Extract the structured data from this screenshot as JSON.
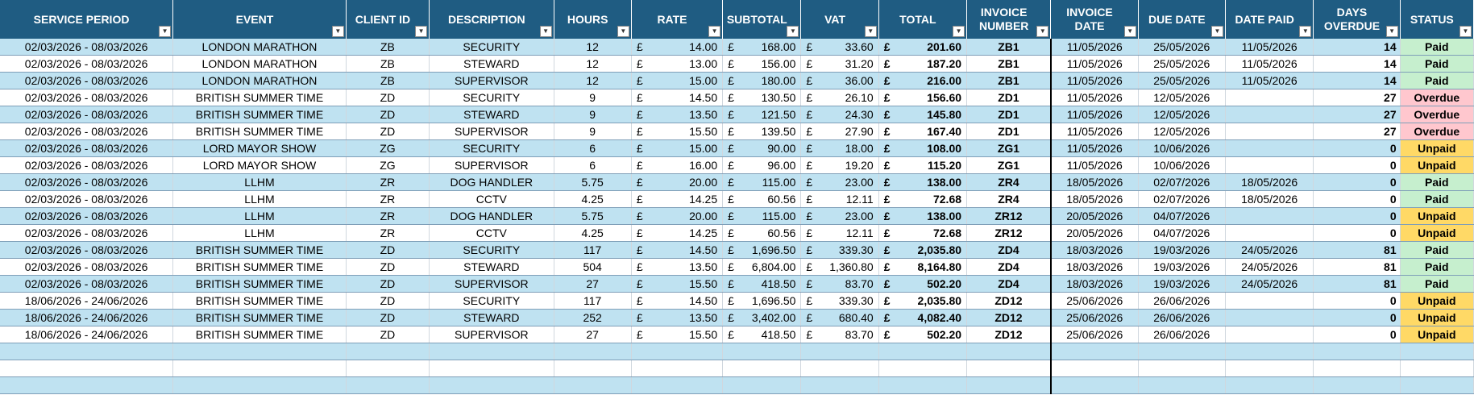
{
  "headers": [
    {
      "label": "SERVICE PERIOD"
    },
    {
      "label": "EVENT"
    },
    {
      "label": "CLIENT ID"
    },
    {
      "label": "DESCRIPTION"
    },
    {
      "label": "HOURS"
    },
    {
      "label": "RATE"
    },
    {
      "label": "SUBTOTAL"
    },
    {
      "label": "VAT"
    },
    {
      "label": "TOTAL"
    },
    {
      "label": "INVOICE NUMBER"
    },
    {
      "label": "INVOICE DATE"
    },
    {
      "label": "DUE DATE"
    },
    {
      "label": "DATE PAID"
    },
    {
      "label": "DAYS OVERDUE"
    },
    {
      "label": "STATUS"
    }
  ],
  "filter_icon": "dropdown-arrow-icon",
  "currency_symbol": "£",
  "rows": [
    {
      "period": "02/03/2026 - 08/03/2026",
      "event": "LONDON MARATHON",
      "client": "ZB",
      "desc": "SECURITY",
      "hours": "12",
      "rate": "14.00",
      "subtotal": "168.00",
      "vat": "33.60",
      "total": "201.60",
      "invoice": "ZB1",
      "inv_date": "11/05/2026",
      "due": "25/05/2026",
      "paid": "11/05/2026",
      "overdue": "14",
      "status": "Paid"
    },
    {
      "period": "02/03/2026 - 08/03/2026",
      "event": "LONDON MARATHON",
      "client": "ZB",
      "desc": "STEWARD",
      "hours": "12",
      "rate": "13.00",
      "subtotal": "156.00",
      "vat": "31.20",
      "total": "187.20",
      "invoice": "ZB1",
      "inv_date": "11/05/2026",
      "due": "25/05/2026",
      "paid": "11/05/2026",
      "overdue": "14",
      "status": "Paid"
    },
    {
      "period": "02/03/2026 - 08/03/2026",
      "event": "LONDON MARATHON",
      "client": "ZB",
      "desc": "SUPERVISOR",
      "hours": "12",
      "rate": "15.00",
      "subtotal": "180.00",
      "vat": "36.00",
      "total": "216.00",
      "invoice": "ZB1",
      "inv_date": "11/05/2026",
      "due": "25/05/2026",
      "paid": "11/05/2026",
      "overdue": "14",
      "status": "Paid"
    },
    {
      "period": "02/03/2026 - 08/03/2026",
      "event": "BRITISH SUMMER TIME",
      "client": "ZD",
      "desc": "SECURITY",
      "hours": "9",
      "rate": "14.50",
      "subtotal": "130.50",
      "vat": "26.10",
      "total": "156.60",
      "invoice": "ZD1",
      "inv_date": "11/05/2026",
      "due": "12/05/2026",
      "paid": "",
      "overdue": "27",
      "status": "Overdue"
    },
    {
      "period": "02/03/2026 - 08/03/2026",
      "event": "BRITISH SUMMER TIME",
      "client": "ZD",
      "desc": "STEWARD",
      "hours": "9",
      "rate": "13.50",
      "subtotal": "121.50",
      "vat": "24.30",
      "total": "145.80",
      "invoice": "ZD1",
      "inv_date": "11/05/2026",
      "due": "12/05/2026",
      "paid": "",
      "overdue": "27",
      "status": "Overdue"
    },
    {
      "period": "02/03/2026 - 08/03/2026",
      "event": "BRITISH SUMMER TIME",
      "client": "ZD",
      "desc": "SUPERVISOR",
      "hours": "9",
      "rate": "15.50",
      "subtotal": "139.50",
      "vat": "27.90",
      "total": "167.40",
      "invoice": "ZD1",
      "inv_date": "11/05/2026",
      "due": "12/05/2026",
      "paid": "",
      "overdue": "27",
      "status": "Overdue"
    },
    {
      "period": "02/03/2026 - 08/03/2026",
      "event": "LORD MAYOR SHOW",
      "client": "ZG",
      "desc": "SECURITY",
      "hours": "6",
      "rate": "15.00",
      "subtotal": "90.00",
      "vat": "18.00",
      "total": "108.00",
      "invoice": "ZG1",
      "inv_date": "11/05/2026",
      "due": "10/06/2026",
      "paid": "",
      "overdue": "0",
      "status": "Unpaid"
    },
    {
      "period": "02/03/2026 - 08/03/2026",
      "event": "LORD MAYOR SHOW",
      "client": "ZG",
      "desc": "SUPERVISOR",
      "hours": "6",
      "rate": "16.00",
      "subtotal": "96.00",
      "vat": "19.20",
      "total": "115.20",
      "invoice": "ZG1",
      "inv_date": "11/05/2026",
      "due": "10/06/2026",
      "paid": "",
      "overdue": "0",
      "status": "Unpaid"
    },
    {
      "period": "02/03/2026 - 08/03/2026",
      "event": "LLHM",
      "client": "ZR",
      "desc": "DOG HANDLER",
      "hours": "5.75",
      "rate": "20.00",
      "subtotal": "115.00",
      "vat": "23.00",
      "total": "138.00",
      "invoice": "ZR4",
      "inv_date": "18/05/2026",
      "due": "02/07/2026",
      "paid": "18/05/2026",
      "overdue": "0",
      "status": "Paid"
    },
    {
      "period": "02/03/2026 - 08/03/2026",
      "event": "LLHM",
      "client": "ZR",
      "desc": "CCTV",
      "hours": "4.25",
      "rate": "14.25",
      "subtotal": "60.56",
      "vat": "12.11",
      "total": "72.68",
      "invoice": "ZR4",
      "inv_date": "18/05/2026",
      "due": "02/07/2026",
      "paid": "18/05/2026",
      "overdue": "0",
      "status": "Paid"
    },
    {
      "period": "02/03/2026 - 08/03/2026",
      "event": "LLHM",
      "client": "ZR",
      "desc": "DOG HANDLER",
      "hours": "5.75",
      "rate": "20.00",
      "subtotal": "115.00",
      "vat": "23.00",
      "total": "138.00",
      "invoice": "ZR12",
      "inv_date": "20/05/2026",
      "due": "04/07/2026",
      "paid": "",
      "overdue": "0",
      "status": "Unpaid"
    },
    {
      "period": "02/03/2026 - 08/03/2026",
      "event": "LLHM",
      "client": "ZR",
      "desc": "CCTV",
      "hours": "4.25",
      "rate": "14.25",
      "subtotal": "60.56",
      "vat": "12.11",
      "total": "72.68",
      "invoice": "ZR12",
      "inv_date": "20/05/2026",
      "due": "04/07/2026",
      "paid": "",
      "overdue": "0",
      "status": "Unpaid"
    },
    {
      "period": "02/03/2026 - 08/03/2026",
      "event": "BRITISH SUMMER TIME",
      "client": "ZD",
      "desc": "SECURITY",
      "hours": "117",
      "rate": "14.50",
      "subtotal": "1,696.50",
      "vat": "339.30",
      "total": "2,035.80",
      "invoice": "ZD4",
      "inv_date": "18/03/2026",
      "due": "19/03/2026",
      "paid": "24/05/2026",
      "overdue": "81",
      "status": "Paid"
    },
    {
      "period": "02/03/2026 - 08/03/2026",
      "event": "BRITISH SUMMER TIME",
      "client": "ZD",
      "desc": "STEWARD",
      "hours": "504",
      "rate": "13.50",
      "subtotal": "6,804.00",
      "vat": "1,360.80",
      "total": "8,164.80",
      "invoice": "ZD4",
      "inv_date": "18/03/2026",
      "due": "19/03/2026",
      "paid": "24/05/2026",
      "overdue": "81",
      "status": "Paid"
    },
    {
      "period": "02/03/2026 - 08/03/2026",
      "event": "BRITISH SUMMER TIME",
      "client": "ZD",
      "desc": "SUPERVISOR",
      "hours": "27",
      "rate": "15.50",
      "subtotal": "418.50",
      "vat": "83.70",
      "total": "502.20",
      "invoice": "ZD4",
      "inv_date": "18/03/2026",
      "due": "19/03/2026",
      "paid": "24/05/2026",
      "overdue": "81",
      "status": "Paid"
    },
    {
      "period": "18/06/2026 - 24/06/2026",
      "event": "BRITISH SUMMER TIME",
      "client": "ZD",
      "desc": "SECURITY",
      "hours": "117",
      "rate": "14.50",
      "subtotal": "1,696.50",
      "vat": "339.30",
      "total": "2,035.80",
      "invoice": "ZD12",
      "inv_date": "25/06/2026",
      "due": "26/06/2026",
      "paid": "",
      "overdue": "0",
      "status": "Unpaid"
    },
    {
      "period": "18/06/2026 - 24/06/2026",
      "event": "BRITISH SUMMER TIME",
      "client": "ZD",
      "desc": "STEWARD",
      "hours": "252",
      "rate": "13.50",
      "subtotal": "3,402.00",
      "vat": "680.40",
      "total": "4,082.40",
      "invoice": "ZD12",
      "inv_date": "25/06/2026",
      "due": "26/06/2026",
      "paid": "",
      "overdue": "0",
      "status": "Unpaid"
    },
    {
      "period": "18/06/2026 - 24/06/2026",
      "event": "BRITISH SUMMER TIME",
      "client": "ZD",
      "desc": "SUPERVISOR",
      "hours": "27",
      "rate": "15.50",
      "subtotal": "418.50",
      "vat": "83.70",
      "total": "502.20",
      "invoice": "ZD12",
      "inv_date": "25/06/2026",
      "due": "26/06/2026",
      "paid": "",
      "overdue": "0",
      "status": "Unpaid"
    }
  ],
  "colors": {
    "header_bg": "#1f5c82",
    "row_blue": "#bfe2f1",
    "paid": "#c6efce",
    "overdue": "#ffc7ce",
    "unpaid": "#ffd966"
  }
}
